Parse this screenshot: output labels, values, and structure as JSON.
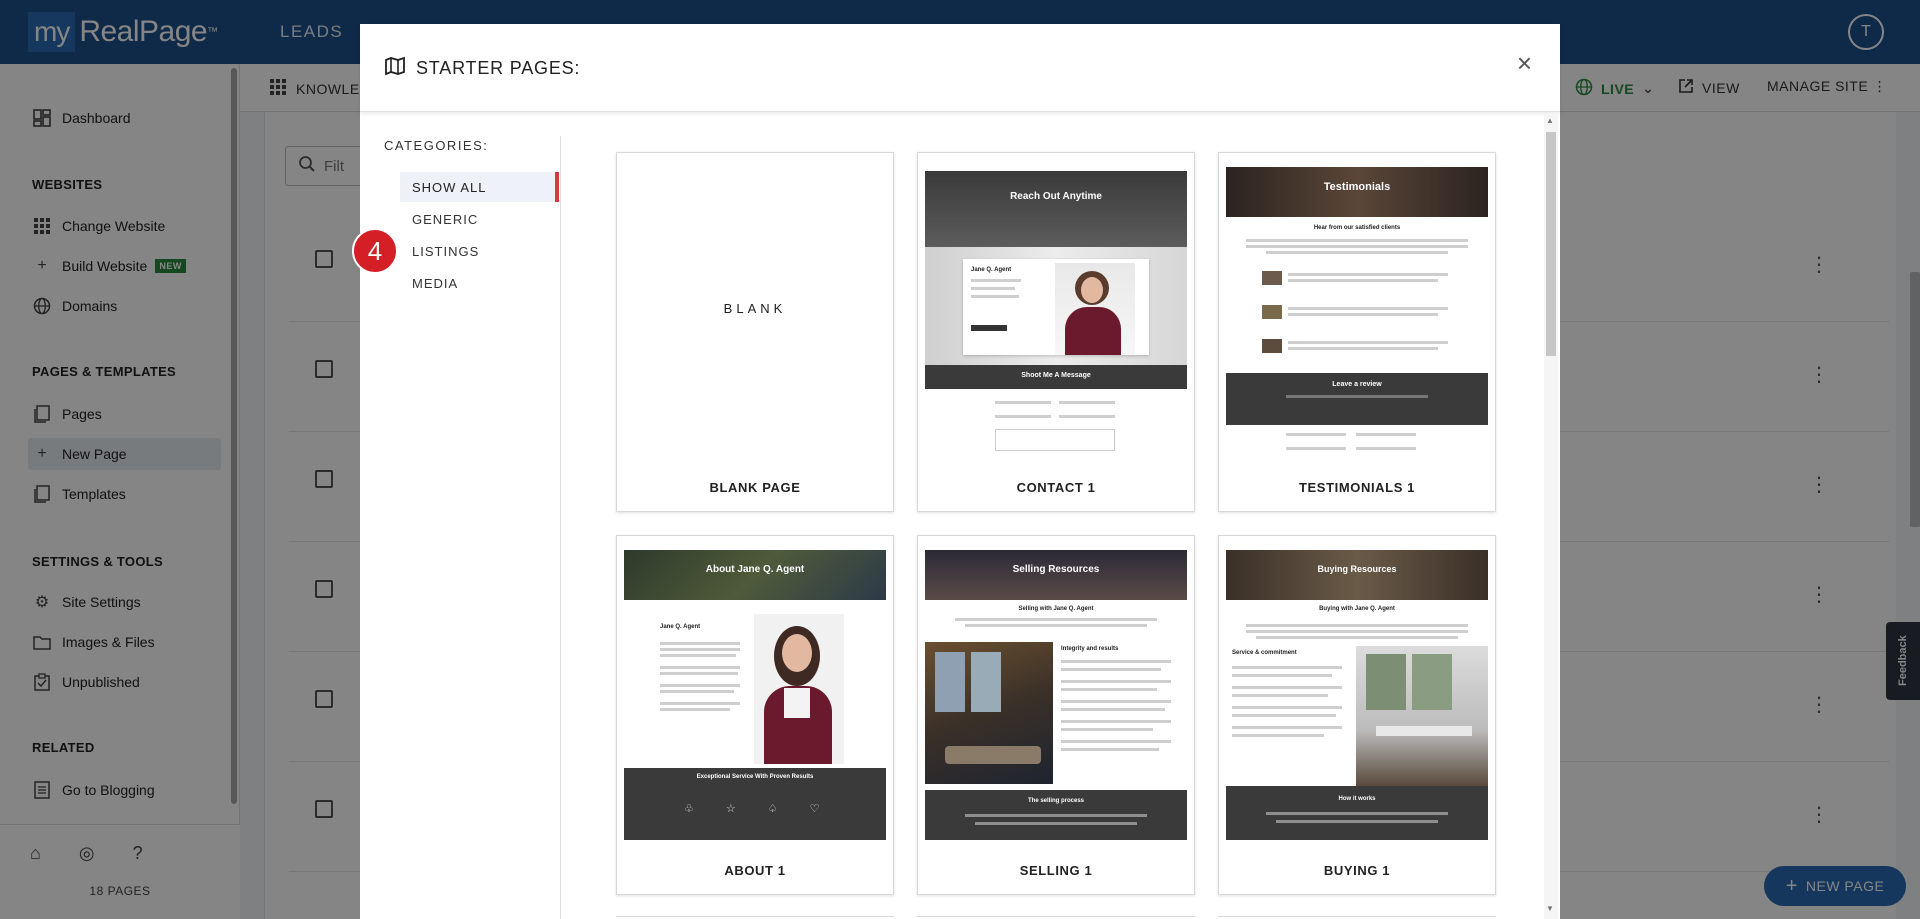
{
  "app": {
    "logo_my": "my",
    "logo_rest": "RealPage",
    "logo_tm": "™",
    "nav_leads": "LEADS",
    "avatar_initial": "T"
  },
  "sidebar": {
    "dashboard": "Dashboard",
    "websites_head": "WEBSITES",
    "change_website": "Change Website",
    "build_website": "Build Website",
    "build_badge": "NEW",
    "domains": "Domains",
    "pages_head": "PAGES & TEMPLATES",
    "pages": "Pages",
    "new_page": "New Page",
    "templates": "Templates",
    "settings_head": "SETTINGS & TOOLS",
    "site_settings": "Site Settings",
    "images_files": "Images & Files",
    "unpublished": "Unpublished",
    "related_head": "RELATED",
    "go_blogging": "Go to Blogging",
    "pages_count": "18 PAGES"
  },
  "toolbar": {
    "knowledge": "KNOWLEDG",
    "live": "LIVE",
    "view": "VIEW",
    "manage_site": "MANAGE SITE",
    "filter_placeholder": "Filt",
    "feedback": "Feedback",
    "new_page_button": "NEW PAGE"
  },
  "modal": {
    "title": "STARTER PAGES:",
    "close": "×",
    "categories_label": "CATEGORIES:",
    "categories": [
      "SHOW ALL",
      "GENERIC",
      "LISTINGS",
      "MEDIA"
    ],
    "selected_category": "SHOW ALL",
    "step_badge": "4",
    "blank_label": "BLANK",
    "templates": [
      {
        "title": "BLANK PAGE"
      },
      {
        "title": "CONTACT 1",
        "hero": "Reach Out Anytime",
        "sub": "Shoot Me A Message",
        "agent": "Jane Q. Agent"
      },
      {
        "title": "TESTIMONIALS 1",
        "hero": "Testimonials",
        "sub": "Hear from our satisfied clients",
        "footer": "Leave a review"
      },
      {
        "title": "ABOUT 1",
        "hero": "About Jane Q. Agent",
        "agent": "Jane Q. Agent",
        "footer": "Exceptional Service With Proven Results"
      },
      {
        "title": "SELLING 1",
        "hero": "Selling Resources",
        "sub": "Selling with Jane Q. Agent",
        "mid": "Integrity and results",
        "footer": "The selling process"
      },
      {
        "title": "BUYING 1",
        "hero": "Buying Resources",
        "sub": "Buying with Jane Q. Agent",
        "mid": "Service & commitment",
        "footer": "How it works"
      }
    ]
  },
  "colors": {
    "topbar": "#1d4f8c",
    "accent": "#d23b3b",
    "live_green": "#2a8a3e",
    "fab_blue": "#2a6ab3"
  }
}
